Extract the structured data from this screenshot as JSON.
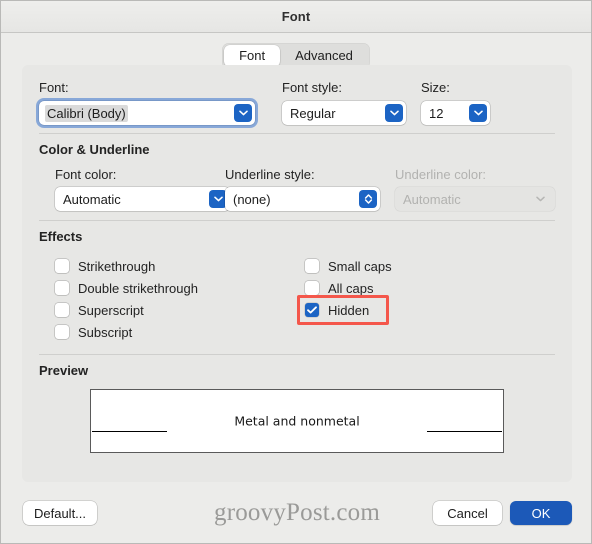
{
  "window": {
    "title": "Font"
  },
  "tabs": [
    {
      "label": "Font",
      "active": true
    },
    {
      "label": "Advanced",
      "active": false
    }
  ],
  "font_section": {
    "font_label": "Font:",
    "font_value": "Calibri (Body)",
    "font_style_label": "Font style:",
    "font_style_value": "Regular",
    "size_label": "Size:",
    "size_value": "12"
  },
  "color_underline_section": {
    "title": "Color & Underline",
    "font_color_label": "Font color:",
    "font_color_value": "Automatic",
    "underline_style_label": "Underline style:",
    "underline_style_value": "(none)",
    "underline_color_label": "Underline color:",
    "underline_color_value": "Automatic",
    "underline_color_disabled": true
  },
  "effects_section": {
    "title": "Effects",
    "left_column": [
      {
        "label": "Strikethrough",
        "checked": false
      },
      {
        "label": "Double strikethrough",
        "checked": false
      },
      {
        "label": "Superscript",
        "checked": false
      },
      {
        "label": "Subscript",
        "checked": false
      }
    ],
    "right_column": [
      {
        "label": "Small caps",
        "checked": false
      },
      {
        "label": "All caps",
        "checked": false
      },
      {
        "label": "Hidden",
        "checked": true,
        "highlighted": true
      }
    ]
  },
  "preview_section": {
    "title": "Preview",
    "sample_text": "Metal and nonmetal"
  },
  "footer": {
    "default_label": "Default...",
    "cancel_label": "Cancel",
    "ok_label": "OK",
    "watermark": "groovyPost.com"
  },
  "colors": {
    "accent_blue": "#1c64c4",
    "primary_button": "#1c59b8",
    "highlight_red": "#f4574b",
    "panel_bg": "#e7e7e5",
    "window_bg": "#ececea"
  },
  "icons": {
    "chevron_down": "chevron-down-icon",
    "chevron_updown": "chevron-up-down-icon",
    "checkmark": "checkmark-icon"
  }
}
